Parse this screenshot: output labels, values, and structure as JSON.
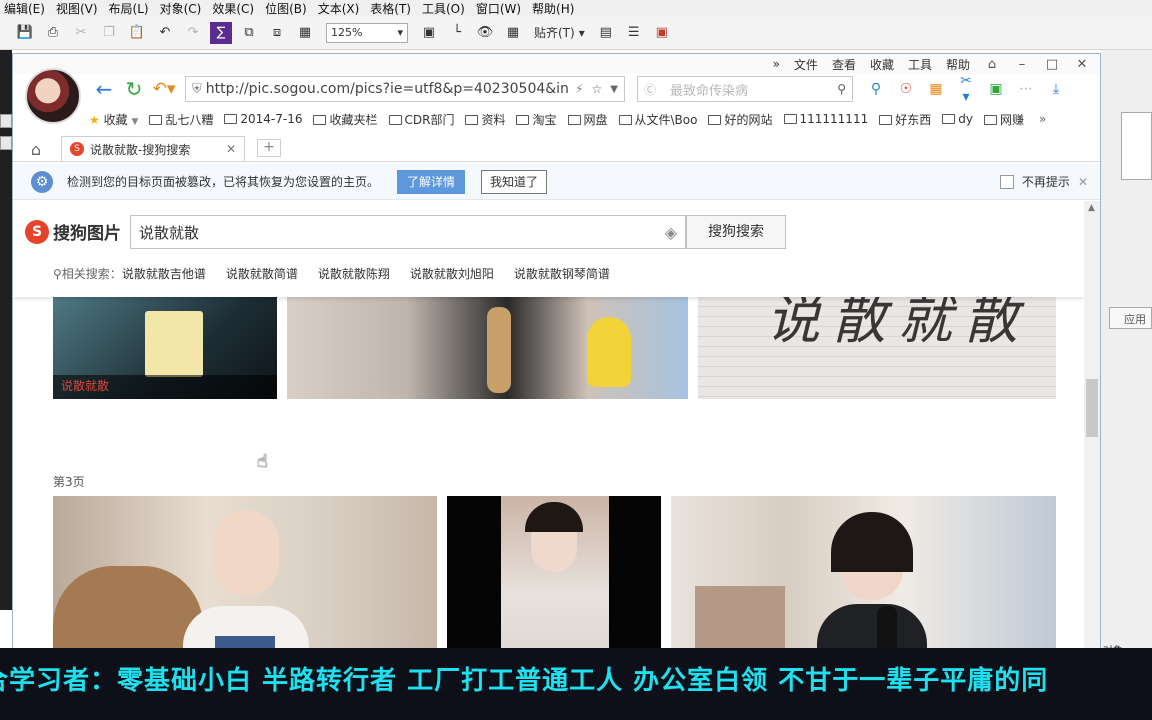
{
  "app_menu": [
    "编辑(E)",
    "视图(V)",
    "布局(L)",
    "对象(C)",
    "效果(C)",
    "位图(B)",
    "文本(X)",
    "表格(T)",
    "工具(O)",
    "窗口(W)",
    "帮助(H)"
  ],
  "app_toolbar": {
    "zoom": "125%",
    "align": "贴齐(T)"
  },
  "app_right": {
    "button": "应用",
    "status": "对象"
  },
  "browser": {
    "menu": [
      "文件",
      "查看",
      "收藏",
      "工具",
      "帮助"
    ],
    "url": "http://pic.sogou.com/pics?ie=utf8&p=40230504&in",
    "search_placeholder": "最致命传染病",
    "bookmarks": [
      "收藏",
      "乱七八糟",
      "2014-7-16",
      "收藏夹栏",
      "CDR部门",
      "资料",
      "淘宝",
      "网盘",
      "从文件\\Boo",
      "好的网站",
      "111111111",
      "好东西",
      "dy",
      "网赚"
    ],
    "tab_title": "说散就散-搜狗搜索",
    "notice": {
      "message": "检测到您的目标页面被篡改，已将其恢复为您设置的主页。",
      "learn_more": "了解详情",
      "got_it": "我知道了",
      "dont_remind": "不再提示"
    }
  },
  "sogou": {
    "logo": "搜狗图片",
    "query": "说散就散",
    "search_button": "搜狗搜索",
    "related_label": "相关搜索：",
    "related": [
      "说散就散吉他谱",
      "说散就散简谱",
      "说散就散陈翔",
      "说散就散刘旭阳",
      "说散就散钢琴简谱"
    ],
    "caption": "说散就散",
    "page_label": "第3页",
    "calligraphy": "说散就散"
  },
  "banner": "合学习者：零基础小白 半路转行者 工厂打工普通工人 办公室白领 不甘于一辈子平庸的同",
  "colors": {
    "sogou_red": "#e6432d",
    "notice_button": "#5d98dc",
    "banner_text": "#1fe0ee",
    "banner_bg": "#0d1018"
  }
}
